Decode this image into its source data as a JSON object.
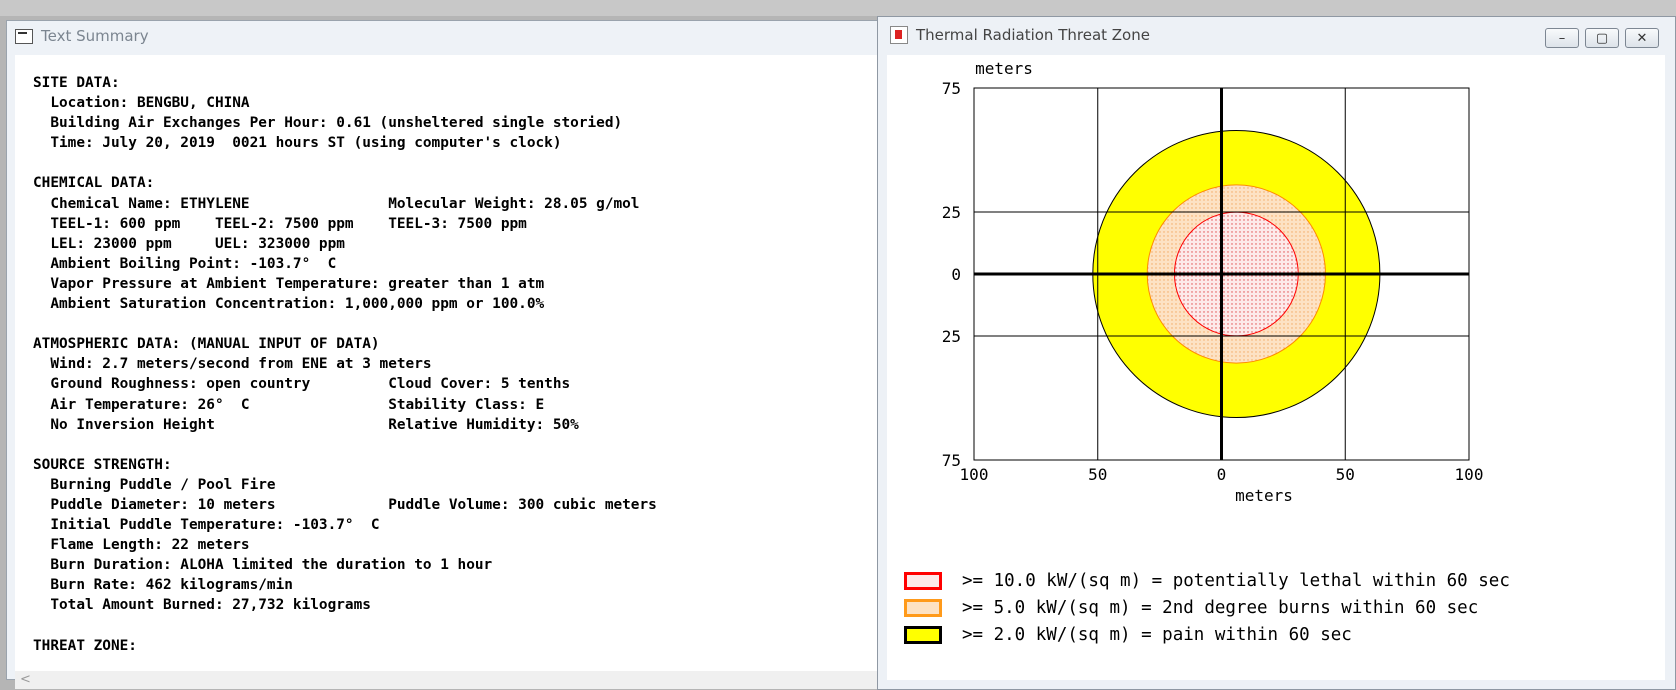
{
  "summary_window": {
    "title": "Text Summary",
    "lines": [
      "SITE DATA:",
      "  Location: BENGBU, CHINA",
      "  Building Air Exchanges Per Hour: 0.61 (unsheltered single storied)",
      "  Time: July 20, 2019  0021 hours ST (using computer's clock)",
      "",
      "CHEMICAL DATA:",
      "  Chemical Name: ETHYLENE                Molecular Weight: 28.05 g/mol",
      "  TEEL-1: 600 ppm    TEEL-2: 7500 ppm    TEEL-3: 7500 ppm",
      "  LEL: 23000 ppm     UEL: 323000 ppm",
      "  Ambient Boiling Point: -103.7°  C",
      "  Vapor Pressure at Ambient Temperature: greater than 1 atm",
      "  Ambient Saturation Concentration: 1,000,000 ppm or 100.0%",
      "",
      "ATMOSPHERIC DATA: (MANUAL INPUT OF DATA)",
      "  Wind: 2.7 meters/second from ENE at 3 meters",
      "  Ground Roughness: open country         Cloud Cover: 5 tenths",
      "  Air Temperature: 26°  C                Stability Class: E",
      "  No Inversion Height                    Relative Humidity: 50%",
      "",
      "SOURCE STRENGTH:",
      "  Burning Puddle / Pool Fire",
      "  Puddle Diameter: 10 meters             Puddle Volume: 300 cubic meters",
      "  Initial Puddle Temperature: -103.7°  C",
      "  Flame Length: 22 meters",
      "  Burn Duration: ALOHA limited the duration to 1 hour",
      "  Burn Rate: 462 kilograms/min",
      "  Total Amount Burned: 27,732 kilograms",
      "",
      "THREAT ZONE:"
    ],
    "scroll_left_glyph": "<"
  },
  "chart_window": {
    "title": "Thermal Radiation Threat Zone",
    "minimize_glyph": "–",
    "maximize_glyph": "▢",
    "close_glyph": "✕",
    "legend": [
      {
        "label": ">= 10.0 kW/(sq m) = potentially lethal within 60 sec",
        "border": "#ff0000",
        "fill": "#fde9e9"
      },
      {
        "label": ">= 5.0 kW/(sq m) = 2nd degree burns within 60 sec",
        "border": "#ff9a1a",
        "fill": "#fde2c4"
      },
      {
        "label": ">= 2.0 kW/(sq m) = pain within 60 sec",
        "border": "#000000",
        "fill": "#ffff00"
      }
    ]
  },
  "chart_data": {
    "type": "area",
    "xlabel": "meters",
    "ylabel": "meters",
    "xlim": [
      -100,
      100
    ],
    "ylim": [
      -75,
      75
    ],
    "x_ticks": [
      -100,
      -50,
      0,
      50,
      100
    ],
    "y_ticks": [
      75,
      25,
      0,
      -25,
      -75
    ],
    "x_tick_labels": [
      "100",
      "50",
      "0",
      "50",
      "100"
    ],
    "y_tick_labels": [
      "75",
      "25",
      "0",
      "25",
      "75"
    ],
    "grid": true,
    "zones": [
      {
        "name": ">= 2.0 kW/(sq m) = pain within 60 sec",
        "center_x": 6,
        "radius": 58,
        "fill": "#ffff00",
        "stroke": "#000000",
        "pattern": "none"
      },
      {
        "name": ">= 5.0 kW/(sq m) = 2nd degree burns within 60 sec",
        "center_x": 6,
        "radius": 36,
        "fill": "#fde2c4",
        "stroke": "#ff8c00",
        "pattern": "dots-orange"
      },
      {
        "name": ">= 10.0 kW/(sq m) = potentially lethal within 60 sec",
        "center_x": 6,
        "radius": 25,
        "fill": "#fdeaea",
        "stroke": "#ff0000",
        "pattern": "dots-red"
      }
    ]
  }
}
